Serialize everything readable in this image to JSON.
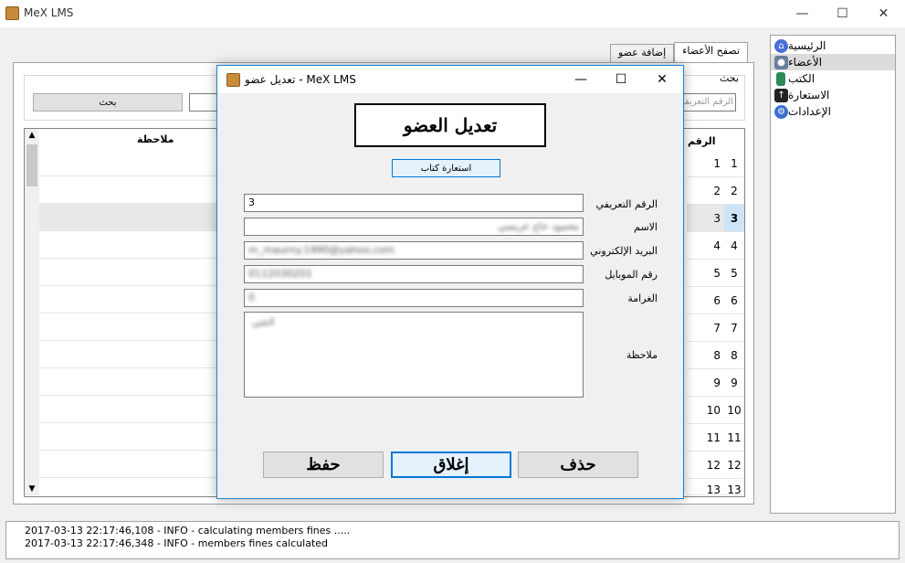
{
  "app": {
    "title": "MeX LMS",
    "min_symbol": "—",
    "max_symbol": "☐",
    "close_symbol": "✕"
  },
  "sidebar": {
    "items": [
      {
        "label": "الرئيسية",
        "icon": "home-icon",
        "color": "#4a6fd8"
      },
      {
        "label": "الأعضاء",
        "icon": "member-icon",
        "color": "#6a7fa0"
      },
      {
        "label": "الكتب",
        "icon": "book-icon",
        "color": "#2e8b57"
      },
      {
        "label": "الاستعارة",
        "icon": "upload-icon",
        "color": "#222222"
      },
      {
        "label": "الإعدادات",
        "icon": "settings-gear-icon",
        "color": "#3a6fd0"
      }
    ]
  },
  "tabs": {
    "browse": "تصفح الأعضاء",
    "add": "إضافة عضو"
  },
  "search": {
    "legend": "بحث",
    "button": "بحث",
    "id_placeholder": "الرقم التعريفي"
  },
  "grid": {
    "columns": {
      "note": "ملاحظة",
      "id": "الرقم"
    },
    "rows": [
      "1",
      "2",
      "3",
      "4",
      "5",
      "6",
      "7",
      "8",
      "9",
      "10",
      "11",
      "12",
      "13"
    ],
    "selected_row": "3"
  },
  "log": {
    "lines": [
      "2017-03-13 22:17:46,108 - INFO - calculating members fines .....",
      "2017-03-13 22:17:46,348 - INFO - members fines calculated"
    ]
  },
  "dialog": {
    "title": "تعديل عضو - MeX LMS",
    "heading": "تعديل العضو",
    "loan_button": "استعارة كتاب",
    "fields": {
      "id_label": "الرقم التعريفي",
      "id_value": "3",
      "name_label": "الاسم",
      "name_value": "محمود حاج عريسي",
      "email_label": "البريد الإلكتروني",
      "email_value": "m_maurny.1990@yahoo.com",
      "mobile_label": "رقم الموبايل",
      "mobile_value": "0112030201",
      "fine_label": "الغرامة",
      "fine_value": "0",
      "note_label": "ملاحظة",
      "note_value": "لاشي"
    },
    "buttons": {
      "save": "حفظ",
      "close": "إغلاق",
      "delete": "حذف"
    }
  }
}
